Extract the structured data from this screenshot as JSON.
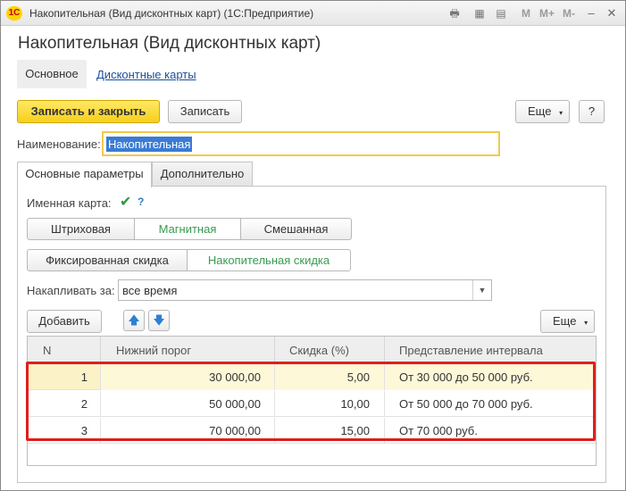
{
  "window": {
    "title": "Накопительная (Вид дисконтных карт)  (1С:Предприятие)",
    "logo": "1С",
    "toolbar_texts": [
      "M",
      "M+",
      "M-"
    ]
  },
  "form": {
    "title": "Накопительная (Вид дисконтных карт)",
    "nav": {
      "current": "Основное",
      "link": "Дисконтные карты"
    },
    "commands": {
      "save_close": "Записать и закрыть",
      "save": "Записать",
      "more": "Еще",
      "help": "?"
    },
    "name_label": "Наименование:",
    "name_value": "Накопительная",
    "tabs": [
      "Основные параметры",
      "Дополнительно"
    ],
    "named_card_label": "Именная карта:",
    "named_card_checked": true,
    "named_card_help": "?",
    "card_type": {
      "options": [
        "Штриховая",
        "Магнитная",
        "Смешанная"
      ],
      "selected": "Магнитная"
    },
    "discount_type": {
      "options": [
        "Фиксированная скидка",
        "Накопительная скидка"
      ],
      "selected": "Накопительная скидка"
    },
    "accumulate_label": "Накапливать за:",
    "accumulate_value": "все время",
    "table_toolbar": {
      "add": "Добавить",
      "more": "Еще"
    },
    "table": {
      "columns": [
        "N",
        "Нижний порог",
        "Скидка (%)",
        "Представление интервала"
      ],
      "rows": [
        {
          "n": "1",
          "threshold": "30 000,00",
          "discount": "5,00",
          "interval": "От 30 000 до 50 000 руб."
        },
        {
          "n": "2",
          "threshold": "50 000,00",
          "discount": "10,00",
          "interval": "От 50 000 до 70 000 руб."
        },
        {
          "n": "3",
          "threshold": "70 000,00",
          "discount": "15,00",
          "interval": "От 70 000 руб."
        }
      ]
    }
  },
  "colors": {
    "primary_button": "#f6cf1c",
    "highlight_border": "#e01e1e",
    "selected_row": "#fbf3c7",
    "active_segment_text": "#3a9a52",
    "link": "#1a4f9c"
  }
}
